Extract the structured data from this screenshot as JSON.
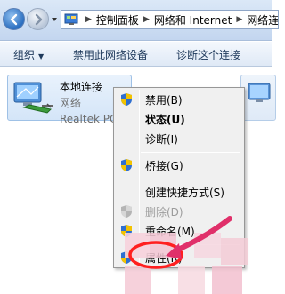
{
  "address_bar": {
    "crumbs": [
      "控制面板",
      "网络和 Internet",
      "网络连接"
    ]
  },
  "command_bar": {
    "organize": "组织",
    "disable_device": "禁用此网络设备",
    "diagnose": "诊断这个连接"
  },
  "connection": {
    "name": "本地连接",
    "type": "网络",
    "adapter": "Realtek PC"
  },
  "context_menu": {
    "items": [
      {
        "label": "禁用(B)",
        "icon": "shield-icon",
        "bold": false,
        "disabled": false
      },
      {
        "label": "状态(U)",
        "icon": "",
        "bold": true,
        "disabled": false
      },
      {
        "label": "诊断(I)",
        "icon": "",
        "bold": false,
        "disabled": false
      },
      {
        "label": "桥接(G)",
        "icon": "shield-icon",
        "bold": false,
        "disabled": false
      },
      {
        "label": "创建快捷方式(S)",
        "icon": "",
        "bold": false,
        "disabled": false
      },
      {
        "label": "删除(D)",
        "icon": "shield-icon",
        "bold": false,
        "disabled": true
      },
      {
        "label": "重命名(M)",
        "icon": "shield-icon",
        "bold": false,
        "disabled": false
      },
      {
        "label": "属性(R)",
        "icon": "shield-icon",
        "bold": false,
        "disabled": false
      }
    ]
  },
  "colors": {
    "accent": "#2c6fc0",
    "annotation": "#e0306a",
    "highlight_circle": "#ff2020"
  }
}
